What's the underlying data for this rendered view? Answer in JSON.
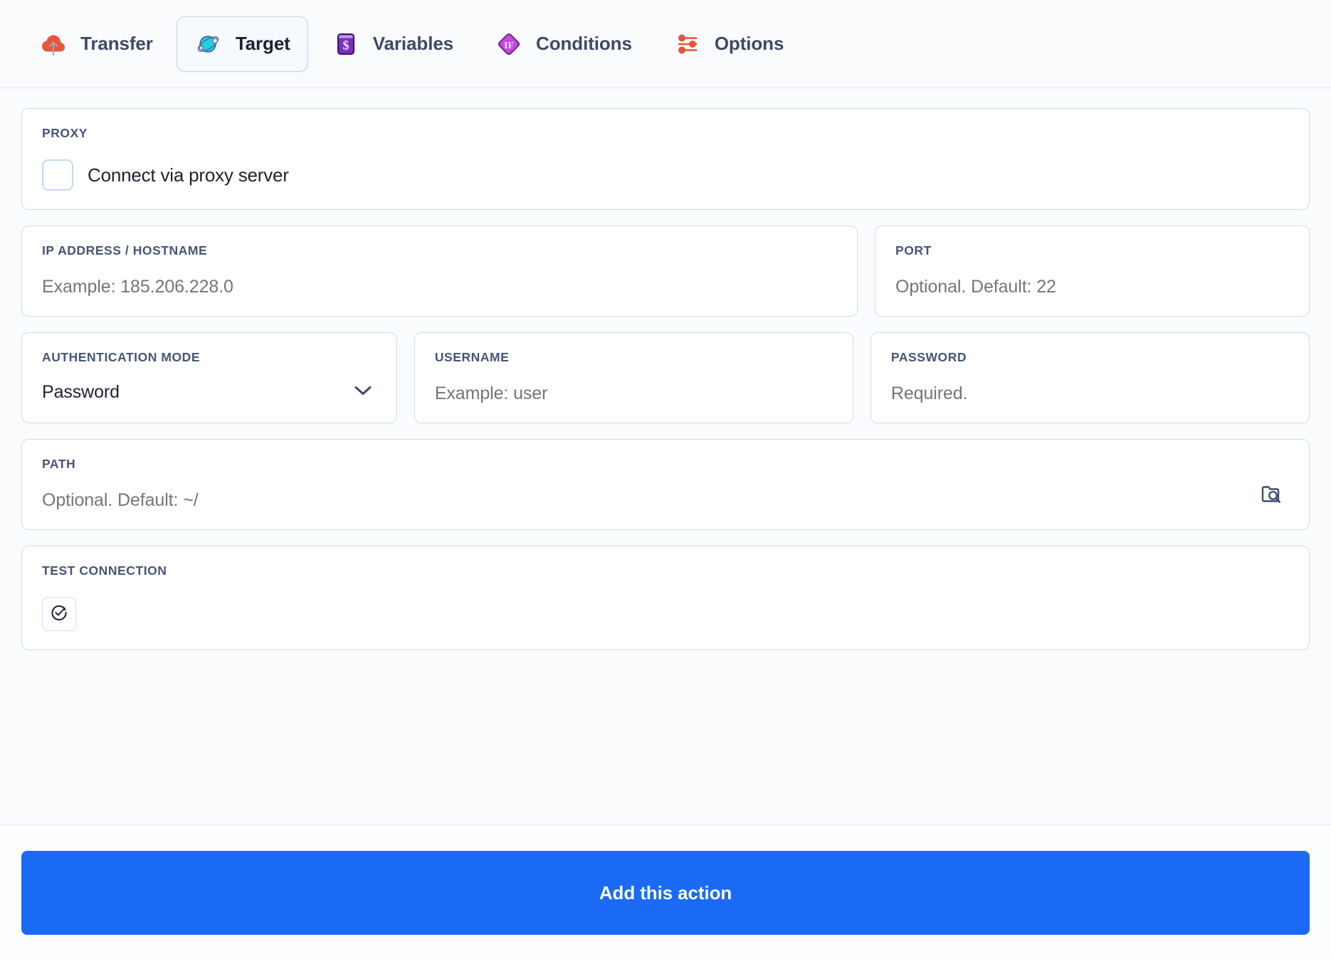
{
  "tabs": [
    {
      "label": "Transfer",
      "icon": "cloud-upload-icon",
      "active": false
    },
    {
      "label": "Target",
      "icon": "planet-icon",
      "active": true
    },
    {
      "label": "Variables",
      "icon": "dollar-card-icon",
      "active": false
    },
    {
      "label": "Conditions",
      "icon": "if-diamond-icon",
      "active": false
    },
    {
      "label": "Options",
      "icon": "sliders-icon",
      "active": false
    }
  ],
  "proxy": {
    "label": "PROXY",
    "checkbox_label": "Connect via proxy server",
    "checked": false
  },
  "host": {
    "label": "IP ADDRESS / HOSTNAME",
    "value": "",
    "placeholder": "Example: 185.206.228.0"
  },
  "port": {
    "label": "PORT",
    "value": "",
    "placeholder": "Optional. Default: 22"
  },
  "auth_mode": {
    "label": "AUTHENTICATION MODE",
    "value": "Password",
    "options": [
      "Password"
    ],
    "chevron_icon": "chevron-down-icon"
  },
  "username": {
    "label": "USERNAME",
    "value": "",
    "placeholder": "Example: user"
  },
  "password": {
    "label": "PASSWORD",
    "value": "",
    "placeholder": "Required."
  },
  "path": {
    "label": "PATH",
    "value": "",
    "placeholder": "Optional. Default: ~/",
    "browse_icon": "folder-search-icon"
  },
  "test_connection": {
    "label": "TEST CONNECTION",
    "button_icon": "circle-check-arrow-icon"
  },
  "footer": {
    "submit_label": "Add this action"
  },
  "colors": {
    "accent_blue": "#1a6af5",
    "tab_text": "#3d4a68",
    "label_text": "#46557a",
    "placeholder": "#8898bb",
    "card_border": "#cdddf0",
    "icon_orange": "#e8533a",
    "icon_cyan": "#24cfe0",
    "icon_purple": "#7b2fbe",
    "icon_magenta": "#c24ad8"
  }
}
